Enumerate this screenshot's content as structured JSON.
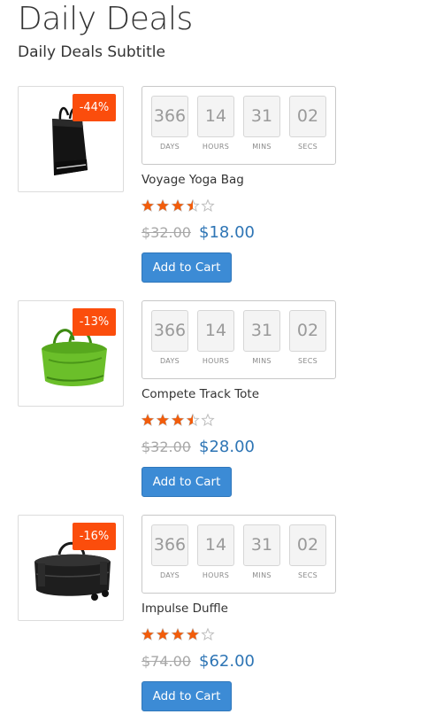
{
  "header": {
    "title": "Daily Deals",
    "subtitle": "Daily Deals Subtitle"
  },
  "countdown_labels": {
    "days": "DAYS",
    "hours": "HOURS",
    "mins": "MINS",
    "secs": "SECS"
  },
  "colors": {
    "badge": "#fb4d0c",
    "star": "#f25c0a",
    "price": "#2e75b5",
    "button": "#3c8bd5"
  },
  "deals": [
    {
      "image": "black-tote-bag",
      "discount": "-44%",
      "countdown": {
        "days": "366",
        "hours": "14",
        "mins": "31",
        "secs": "02"
      },
      "name": "Voyage Yoga Bag",
      "rating": 3.5,
      "old_price": "$32.00",
      "new_price": "$18.00",
      "cta": "Add to Cart"
    },
    {
      "image": "green-duffle-bag",
      "discount": "-13%",
      "countdown": {
        "days": "366",
        "hours": "14",
        "mins": "31",
        "secs": "02"
      },
      "name": "Compete Track Tote",
      "rating": 3.5,
      "old_price": "$32.00",
      "new_price": "$28.00",
      "cta": "Add to Cart"
    },
    {
      "image": "black-rolling-duffle",
      "discount": "-16%",
      "countdown": {
        "days": "366",
        "hours": "14",
        "mins": "31",
        "secs": "02"
      },
      "name": "Impulse Duffle",
      "rating": 4,
      "old_price": "$74.00",
      "new_price": "$62.00",
      "cta": "Add to Cart"
    }
  ]
}
